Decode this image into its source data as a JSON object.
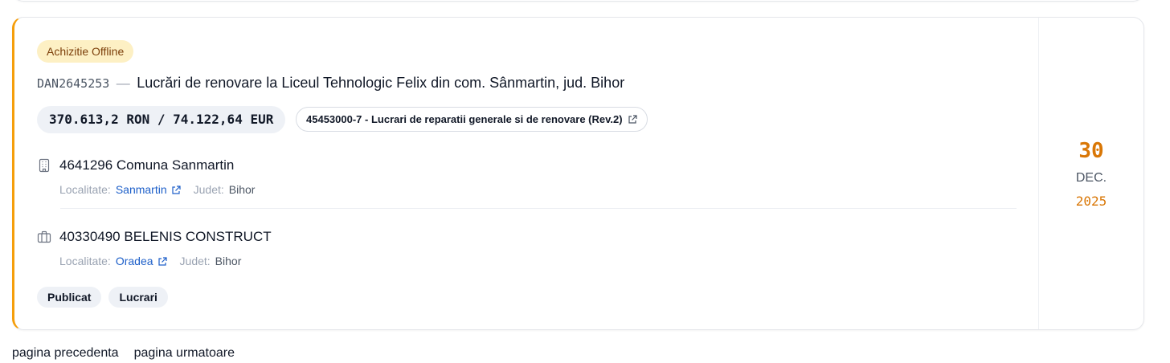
{
  "listing": {
    "type_badge": "Achizitie Offline",
    "code": "DAN2645253",
    "separator": "—",
    "title": "Lucrări de renovare la Liceul Tehnologic Felix din com. Sânmartin, jud. Bihor",
    "value": "370.613,2 RON / 74.122,64 EUR",
    "cpv": "45453000-7 - Lucrari de reparatii generale si de renovare (Rev.2)",
    "authority": {
      "name": "4641296 Comuna Sanmartin",
      "locality_label": "Localitate:",
      "locality": "Sanmartin",
      "county_label": "Judet:",
      "county": "Bihor",
      "icon": "building-icon"
    },
    "supplier": {
      "name": "40330490 BELENIS CONSTRUCT",
      "locality_label": "Localitate:",
      "locality": "Oradea",
      "county_label": "Judet:",
      "county": "Bihor",
      "icon": "briefcase-icon"
    },
    "tags": [
      "Publicat",
      "Lucrari"
    ],
    "date": {
      "day": "30",
      "month": "DEC.",
      "year": "2025"
    }
  },
  "pagination": {
    "prev_label": "pagina precedenta",
    "next_label": "pagina urmatoare"
  },
  "colors": {
    "accent": "#f59e0b",
    "date": "#d97706",
    "badge_bg": "#fdf0c4",
    "link": "#1d5fc9"
  }
}
